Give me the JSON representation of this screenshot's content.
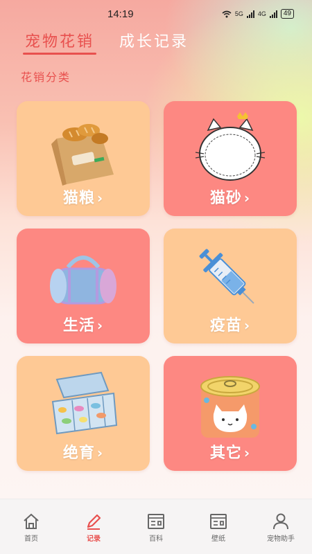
{
  "status_bar": {
    "time": "14:19",
    "network_label_1": "5G",
    "network_label_2": "4G",
    "battery": "49"
  },
  "tabs": [
    {
      "label": "宠物花销",
      "active": true
    },
    {
      "label": "成长记录",
      "active": false
    }
  ],
  "section_title": "花销分类",
  "categories": [
    {
      "label": "猫粮",
      "chevron": "›",
      "color": "#fec995",
      "icon": "food-bag-icon"
    },
    {
      "label": "猫砂",
      "chevron": "›",
      "color": "#fd8882",
      "icon": "cat-litter-icon"
    },
    {
      "label": "生活",
      "chevron": "›",
      "color": "#fd8882",
      "icon": "duffel-bag-icon"
    },
    {
      "label": "疫苗",
      "chevron": "›",
      "color": "#fec995",
      "icon": "syringe-icon"
    },
    {
      "label": "绝育",
      "chevron": "›",
      "color": "#fec995",
      "icon": "pill-box-icon"
    },
    {
      "label": "其它",
      "chevron": "›",
      "color": "#fd8882",
      "icon": "cat-can-icon"
    }
  ],
  "bottom_nav": [
    {
      "label": "首页",
      "icon": "home-icon",
      "active": false
    },
    {
      "label": "记录",
      "icon": "pencil-icon",
      "active": true
    },
    {
      "label": "百科",
      "icon": "encyclopedia-icon",
      "active": false
    },
    {
      "label": "壁纸",
      "icon": "wallpaper-icon",
      "active": false
    },
    {
      "label": "宠物助手",
      "icon": "user-icon",
      "active": false
    }
  ],
  "colors": {
    "accent": "#e8504e",
    "card_peach": "#fec995",
    "card_rose": "#fd8882"
  }
}
